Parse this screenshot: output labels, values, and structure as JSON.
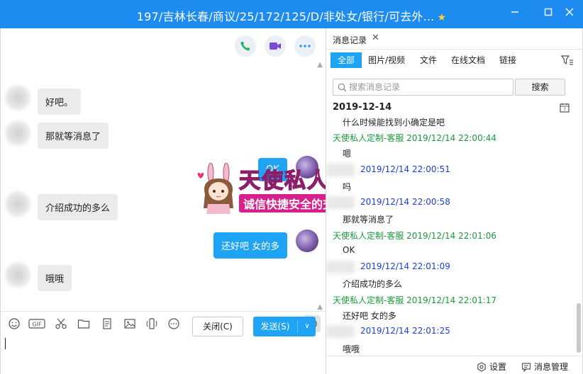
{
  "window": {
    "title": "197/吉林长春/商议/25/172/125/D/非处女/银行/可去外...",
    "star_icon": "star-icon",
    "minimize_icon": "minimize-icon",
    "maximize_icon": "maximize-icon",
    "close_icon": "close-icon",
    "accent_color": "#1e8bf1"
  },
  "chat": {
    "call_buttons": [
      "phone-icon",
      "video-call-icon",
      "more-icon"
    ],
    "messages": [
      {
        "side": "in",
        "text": "好吧。"
      },
      {
        "side": "in",
        "text": "那就等消息了"
      },
      {
        "side": "out",
        "text": "OK"
      },
      {
        "side": "in",
        "text": "介绍成功的多么"
      },
      {
        "side": "out",
        "text": "还好吧 女的多"
      },
      {
        "side": "in",
        "text": "哦哦"
      }
    ]
  },
  "ad": {
    "title": "天使私人订制",
    "subtitle": "诚信快捷安全的交友平台"
  },
  "toolbar": {
    "icons": [
      "emoji-icon",
      "gif-icon",
      "scissors-icon",
      "folder-icon",
      "document-icon",
      "image-icon",
      "shake-icon",
      "more-icon"
    ],
    "gif_label": "GIF",
    "history_icon": "clock-icon"
  },
  "compose": {
    "close_label": "关闭(C)",
    "send_label": "发送(S)"
  },
  "history": {
    "tab_label": "消息记录",
    "filters": [
      "全部",
      "图片/视频",
      "文件",
      "在线文档",
      "链接"
    ],
    "active_filter": "全部",
    "search_placeholder": "搜索消息记录",
    "search_button": "搜索",
    "date": "2019-12-14",
    "records": [
      {
        "type": "text",
        "text": "什么时候能找到小确定是吧"
      },
      {
        "type": "sender",
        "text": "天使私人定制-客服 2019/12/14 22:00:44"
      },
      {
        "type": "text",
        "text": "嗯"
      },
      {
        "type": "self",
        "text": "2019/12/14 22:00:51"
      },
      {
        "type": "text",
        "text": "吗"
      },
      {
        "type": "self",
        "text": "2019/12/14 22:00:58"
      },
      {
        "type": "text",
        "text": "那就等消息了"
      },
      {
        "type": "sender",
        "text": "天使私人定制-客服 2019/12/14 22:01:06"
      },
      {
        "type": "text",
        "text": "OK"
      },
      {
        "type": "self",
        "text": "2019/12/14 22:01:09"
      },
      {
        "type": "text",
        "text": "介绍成功的多么"
      },
      {
        "type": "sender",
        "text": "天使私人定制-客服 2019/12/14 22:01:17"
      },
      {
        "type": "text",
        "text": "还好吧 女的多"
      },
      {
        "type": "self",
        "text": "2019/12/14 22:01:25"
      },
      {
        "type": "text",
        "text": "哦哦"
      }
    ],
    "settings_label": "设置",
    "manage_label": "消息管理",
    "sender_color": "#1a9a3a",
    "self_color": "#1a3fd6"
  }
}
